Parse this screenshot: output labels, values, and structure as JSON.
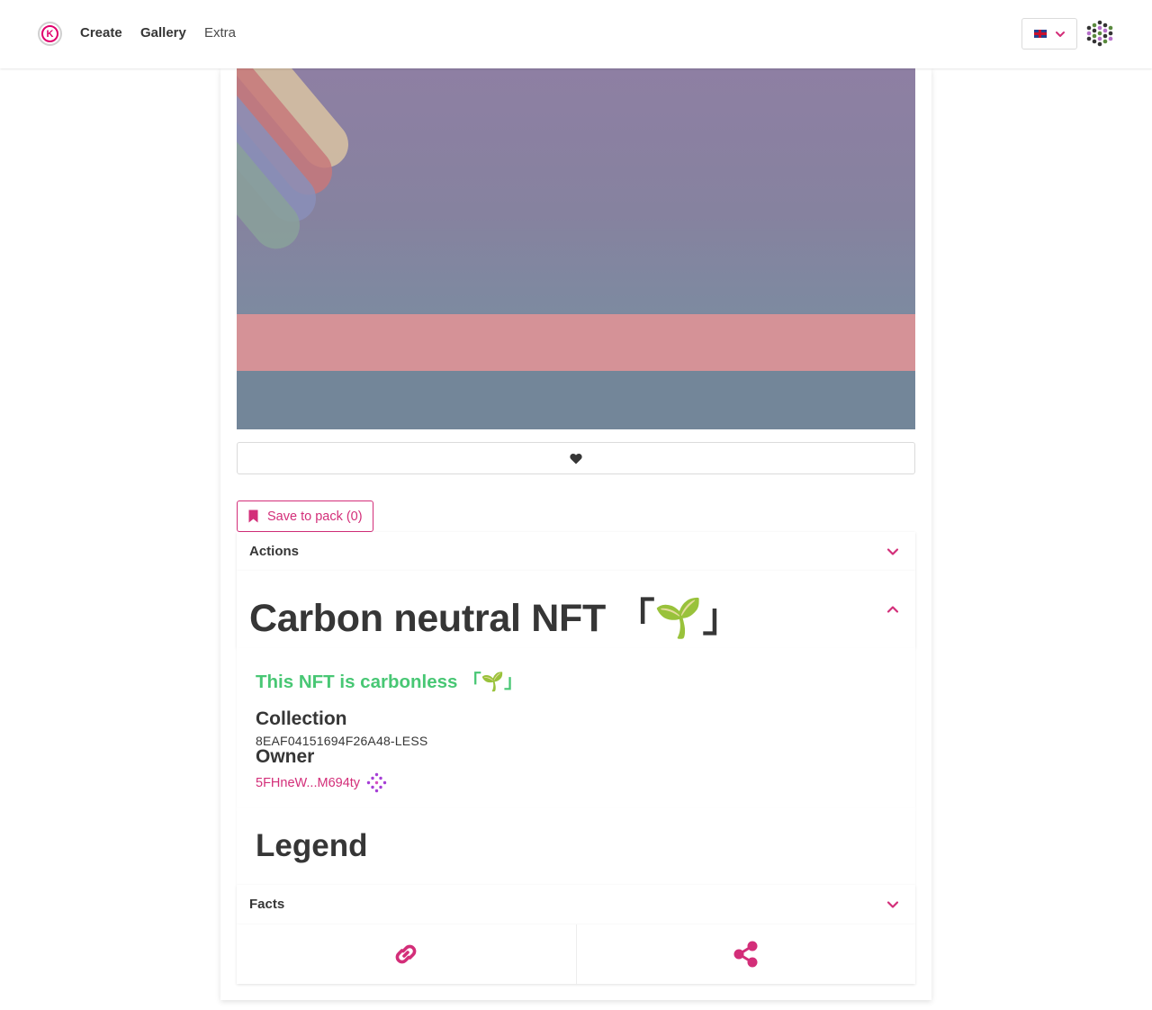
{
  "nav": {
    "links": [
      "Create",
      "Gallery",
      "Extra"
    ]
  },
  "artwork": {
    "alt": ""
  },
  "actions": {
    "save_label": "Save to pack (0)"
  },
  "sections": {
    "actions_label": "Actions",
    "facts_label": "Facts"
  },
  "nft": {
    "title": "Carbon neutral NFT 「🌱」",
    "carbon_note": "This NFT is carbonless 「🌱」",
    "collection_heading": "Collection",
    "collection_id": "8EAF04151694F26A48-LESS",
    "owner_heading": "Owner",
    "owner_address": "5FHneW...M694ty",
    "legend_heading": "Legend"
  },
  "icons": {
    "logo": "kodadot-logo-icon",
    "language": "uk-flag-icon",
    "like": "heart-icon",
    "save": "bookmark-icon",
    "link": "link-icon",
    "share": "share-icon"
  },
  "colors": {
    "accent": "#d32e79",
    "carbon": "#48c774",
    "text": "#363636"
  }
}
